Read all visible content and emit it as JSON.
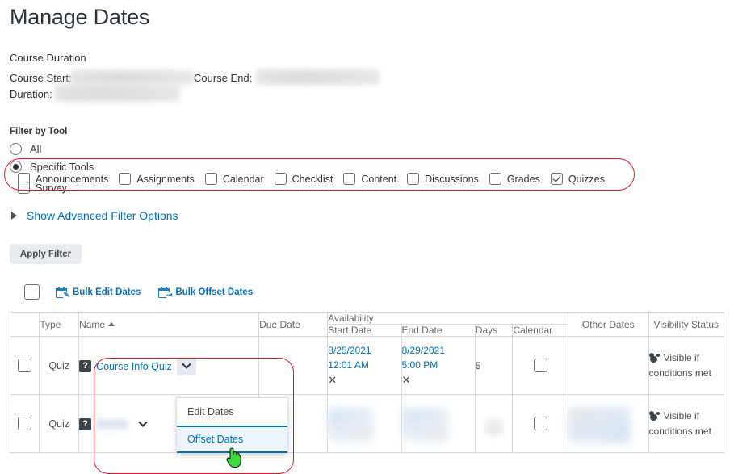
{
  "page": {
    "title": "Manage Dates"
  },
  "course_duration": {
    "section_label": "Course Duration",
    "start_label": "Course Start:",
    "end_label": "Course End:",
    "duration_label": "Duration:",
    "start_value": "",
    "end_value": "",
    "duration_value": ""
  },
  "filter": {
    "heading": "Filter by Tool",
    "options": [
      {
        "label": "All",
        "selected": false
      },
      {
        "label": "Specific Tools",
        "selected": true
      }
    ],
    "tools": [
      {
        "label": "Announcements",
        "checked": false
      },
      {
        "label": "Assignments",
        "checked": false
      },
      {
        "label": "Calendar",
        "checked": false
      },
      {
        "label": "Checklist",
        "checked": false
      },
      {
        "label": "Content",
        "checked": false
      },
      {
        "label": "Discussions",
        "checked": false
      },
      {
        "label": "Grades",
        "checked": false
      },
      {
        "label": "Quizzes",
        "checked": true
      },
      {
        "label": "Survey",
        "checked": false
      }
    ],
    "advanced_link": "Show Advanced Filter Options",
    "apply_button": "Apply Filter",
    "highlight_color": "#e01b24"
  },
  "bulk_toolbar": {
    "edit_dates": "Bulk Edit Dates",
    "offset_dates": "Bulk Offset Dates",
    "link_color": "#006fbf"
  },
  "table": {
    "group_headers": {
      "availability": "Availability",
      "other_dates": "Other Dates",
      "visibility_status": "Visibility Status",
      "type": "Type",
      "name": "Name",
      "due_date": "Due Date"
    },
    "sub_headers": {
      "start_date": "Start Date",
      "end_date": "End Date",
      "days": "Days",
      "calendar": "Calendar"
    },
    "rows": [
      {
        "type": "Quiz",
        "name": "Course Info Quiz",
        "name_blurred": false,
        "due_date": "-",
        "start_date": "8/25/2021",
        "start_time": "12:01 AM",
        "start_clear": "✕",
        "end_date": "8/29/2021",
        "end_time": "5:00 PM",
        "end_clear": "✕",
        "days": "5",
        "other_dates": "",
        "visibility": "Visible if conditions met",
        "blurred": false
      },
      {
        "type": "Quiz",
        "name": "",
        "name_blurred": true,
        "due_date": "",
        "start_date": "",
        "start_time": "",
        "start_clear": "",
        "end_date": "",
        "end_time": "",
        "end_clear": "",
        "days": "",
        "other_dates": "",
        "visibility": "Visible if conditions met",
        "blurred": true
      }
    ]
  },
  "context_menu": {
    "items": [
      {
        "label": "Edit Dates",
        "active": false
      },
      {
        "label": "Offset Dates",
        "active": true
      }
    ],
    "active_color": "#006fbf",
    "active_bg": "#eaf5fc"
  },
  "icons": {
    "quiz": "?",
    "chevron_down": "chevron-down-icon",
    "cursor": "hand-pointer-cursor"
  }
}
